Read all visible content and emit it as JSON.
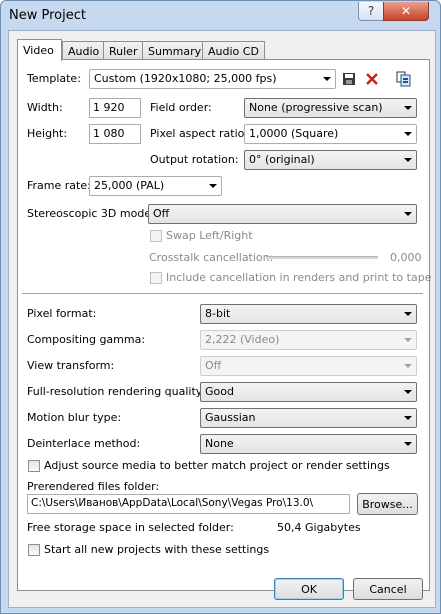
{
  "window": {
    "title": "New Project",
    "help_glyph": "?",
    "close_glyph": "✕"
  },
  "tabs": [
    "Video",
    "Audio",
    "Ruler",
    "Summary",
    "Audio CD"
  ],
  "template": {
    "label": "Template:",
    "value": "Custom (1920x1080; 25,000 fps)",
    "icons": [
      "save-icon",
      "delete-icon",
      "match-media-icon"
    ]
  },
  "width": {
    "label": "Width:",
    "value": "1 920"
  },
  "height": {
    "label": "Height:",
    "value": "1 080"
  },
  "field_order": {
    "label": "Field order:",
    "value": "None (progressive scan)"
  },
  "pixel_aspect": {
    "label": "Pixel aspect ratio:",
    "value": "1,0000 (Square)"
  },
  "output_rotation": {
    "label": "Output rotation:",
    "value": "0° (original)"
  },
  "frame_rate": {
    "label": "Frame rate:",
    "value": "25,000 (PAL)"
  },
  "stereo": {
    "label": "Stereoscopic 3D mode:",
    "value": "Off",
    "swap_label": "Swap Left/Right",
    "crosstalk_label": "Crosstalk cancellation:",
    "crosstalk_value": "0,000",
    "include_label": "Include cancellation in renders and print to tape"
  },
  "pixel_format": {
    "label": "Pixel format:",
    "value": "8-bit"
  },
  "compositing_gamma": {
    "label": "Compositing gamma:",
    "value": "2,222 (Video)"
  },
  "view_transform": {
    "label": "View transform:",
    "value": "Off"
  },
  "render_quality": {
    "label": "Full-resolution rendering quality:",
    "value": "Good"
  },
  "motion_blur": {
    "label": "Motion blur type:",
    "value": "Gaussian"
  },
  "deinterlace": {
    "label": "Deinterlace method:",
    "value": "None"
  },
  "adjust_media": {
    "label": "Adjust source media to better match project or render settings"
  },
  "prerendered": {
    "label": "Prerendered files folder:",
    "value": "C:\\Users\\Иванов\\AppData\\Local\\Sony\\Vegas Pro\\13.0\\",
    "browse_label": "Browse..."
  },
  "free_storage": {
    "label": "Free storage space in selected folder:",
    "value": "50,4 Gigabytes"
  },
  "start_all": {
    "label": "Start all new projects with these settings"
  },
  "buttons": {
    "ok": "OK",
    "cancel": "Cancel"
  }
}
